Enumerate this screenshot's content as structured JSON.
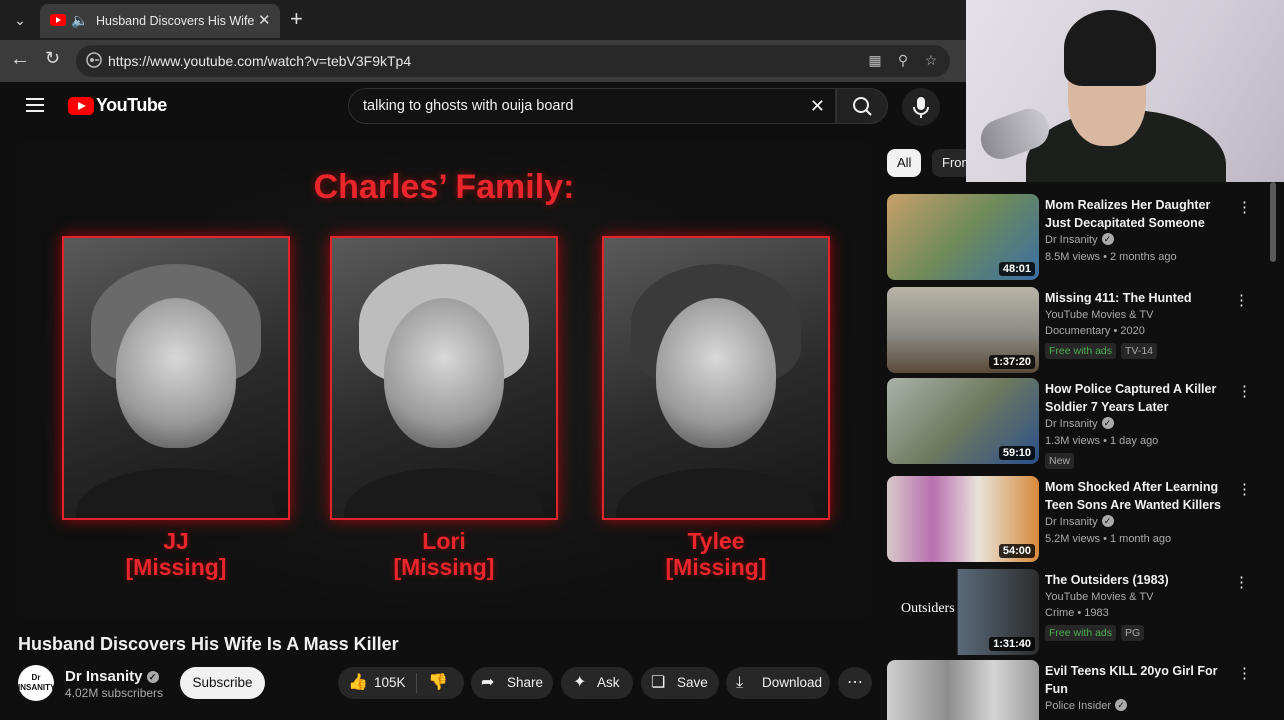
{
  "browser": {
    "tab_title": "Husband Discovers His Wife Is",
    "url": "https://www.youtube.com/watch?v=tebV3F9kTp4"
  },
  "youtube": {
    "logo_text": "YouTube",
    "search_query": "talking to ghosts with ouija board"
  },
  "video": {
    "heading": "Charles’ Family:",
    "people": [
      {
        "name": "JJ",
        "status": "[Missing]"
      },
      {
        "name": "Lori",
        "status": "[Missing]"
      },
      {
        "name": "Tylee",
        "status": "[Missing]"
      }
    ],
    "title": "Husband Discovers His Wife Is A Mass Killer",
    "channel": "Dr Insanity",
    "channel_avatar": "Dr INSANITY",
    "subscribers": "4.02M subscribers",
    "subscribe_label": "Subscribe",
    "likes": "105K",
    "share_label": "Share",
    "ask_label": "Ask",
    "save_label": "Save",
    "download_label": "Download"
  },
  "sidebar": {
    "chips": [
      "All",
      "From"
    ],
    "recommendations": [
      {
        "title": "Mom Realizes Her Daughter Just Decapitated Someone",
        "channel": "Dr Insanity",
        "meta": "8.5M views • 2 months ago",
        "duration": "48:01",
        "thumb_color": "#6d8a5a"
      },
      {
        "title": "Missing 411: The Hunted",
        "channel": "YouTube Movies & TV",
        "meta": "Documentary • 2020",
        "duration": "1:37:20",
        "badge1": "Free with ads",
        "badge2": "TV-14",
        "thumb_color": "#8a8a84"
      },
      {
        "title": "How Police Captured A Killer Soldier 7 Years Later",
        "channel": "Dr Insanity",
        "meta": "1.3M views • 1 day ago",
        "duration": "59:10",
        "badge1": "New",
        "thumb_color": "#9aa39a"
      },
      {
        "title": "Mom Shocked After Learning Teen Sons Are Wanted Killers",
        "channel": "Dr Insanity",
        "meta": "5.2M views • 1 month ago",
        "duration": "54:00",
        "thumb_color": "#c9b8b0"
      },
      {
        "title": "The Outsiders (1983)",
        "channel": "YouTube Movies & TV",
        "meta": "Crime • 1983",
        "duration": "1:31:40",
        "badge1": "Free with ads",
        "badge2": "PG",
        "thumb_color": "#2c2c2c",
        "thumb_text": "Outsiders"
      },
      {
        "title": "Evil Teens KILL 20yo Girl For Fun",
        "channel": "Police Insider",
        "thumb_color": "#8d8d8d"
      }
    ]
  },
  "colors": {
    "youtube_red": "#ff0000",
    "accent_red": "#e8262c",
    "badge_green": "#3ea6ff"
  }
}
